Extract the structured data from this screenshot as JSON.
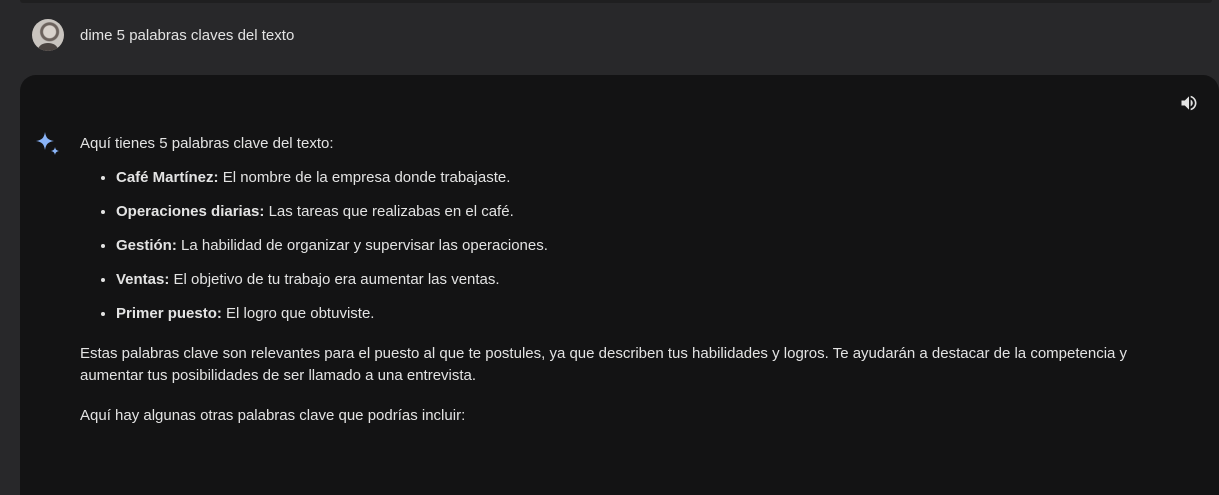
{
  "prompt": {
    "text": "dime 5 palabras claves del texto"
  },
  "response": {
    "intro": "Aquí tienes 5 palabras clave del texto:",
    "keywords": [
      {
        "term": "Café Martínez:",
        "desc": " El nombre de la empresa donde trabajaste."
      },
      {
        "term": "Operaciones diarias:",
        "desc": " Las tareas que realizabas en el café."
      },
      {
        "term": "Gestión:",
        "desc": " La habilidad de organizar y supervisar las operaciones."
      },
      {
        "term": "Ventas:",
        "desc": " El objetivo de tu trabajo era aumentar las ventas."
      },
      {
        "term": "Primer puesto:",
        "desc": " El logro que obtuviste."
      }
    ],
    "paragraph1": "Estas palabras clave son relevantes para el puesto al que te postules, ya que describen tus habilidades y logros. Te ayudarán a destacar de la competencia y aumentar tus posibilidades de ser llamado a una entrevista.",
    "paragraph2": "Aquí hay algunas otras palabras clave que podrías incluir:"
  },
  "icons": {
    "avatar": "user-avatar",
    "speaker": "speaker-icon",
    "spark": "gemini-spark-icon"
  },
  "colors": {
    "page_bg": "#28282a",
    "card_bg": "#131314",
    "text": "#e3e3e3",
    "spark_blue": "#8ab4f8"
  }
}
